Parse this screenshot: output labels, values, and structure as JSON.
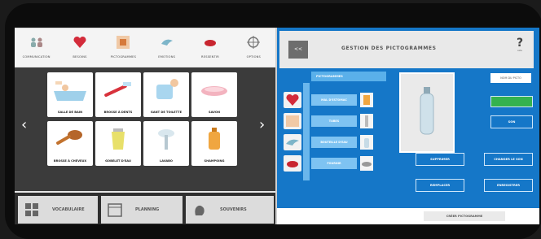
{
  "tabs": [
    {
      "label": "Communication",
      "icon": "people-icon"
    },
    {
      "label": "Besoins",
      "icon": "heart-icon"
    },
    {
      "label": "Pictogrammes",
      "icon": "picto-icon"
    },
    {
      "label": "Emotions",
      "icon": "bird-icon"
    },
    {
      "label": "Ressentir",
      "icon": "lips-icon"
    },
    {
      "label": "Options",
      "icon": "gear-icon"
    }
  ],
  "nav": {
    "prev": "‹",
    "next": "›"
  },
  "cards": [
    {
      "label": "Salle de bain"
    },
    {
      "label": "Brosse à dents"
    },
    {
      "label": "Gant de toilette"
    },
    {
      "label": "Savon"
    },
    {
      "label": "Brosse à cheveux"
    },
    {
      "label": "Gobelet d'eau"
    },
    {
      "label": "Lavabo"
    },
    {
      "label": "Shampoing"
    }
  ],
  "bottom_buttons": [
    {
      "label": "Vocabulaire",
      "icon": "vocab-icon"
    },
    {
      "label": "Planning",
      "icon": "calendar-icon"
    },
    {
      "label": "Souvenirs",
      "icon": "hand-icon"
    }
  ],
  "manager": {
    "back": "<<",
    "title": "Gestion des pictogrammes",
    "help": "?",
    "help_sub": "aide",
    "list_header": "Pictogrammes",
    "rows": [
      "Mal d'estomac",
      "Tubes",
      "Bouteille d'eau",
      "Fournir"
    ],
    "search_field": "Nom du picto",
    "green_label": "",
    "btn_main": "Son",
    "btn_delete": "Supprimer",
    "btn_replace": "Remplacer",
    "btn_change": "Changer le son",
    "btn_record": "Enregistrer",
    "create": "Créer pictogramme"
  },
  "colors": {
    "accent": "#1577c8",
    "panel": "#3b3b3b",
    "green": "#34b24f"
  }
}
